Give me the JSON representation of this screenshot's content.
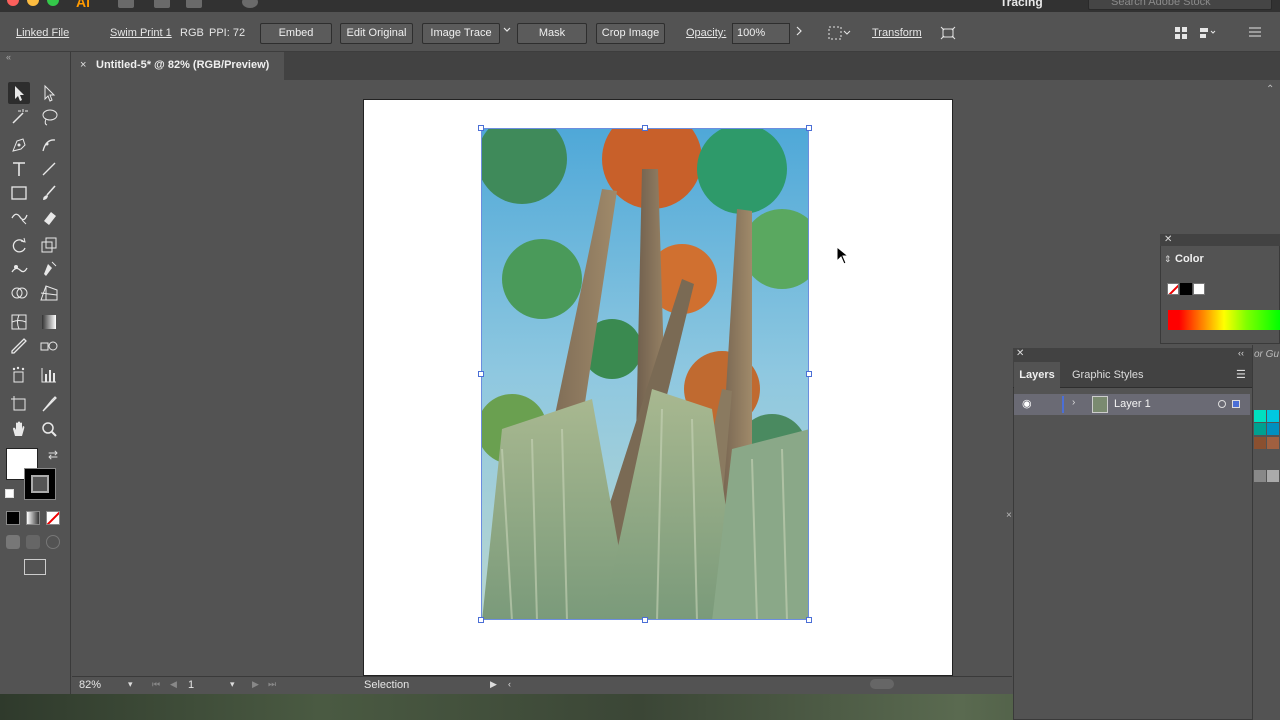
{
  "app": {
    "workspace": "Tracing",
    "stock_search_placeholder": "Search Adobe Stock",
    "logo": "Ai",
    "colors": {
      "selection": "#4b6fd6",
      "panel_bg": "#535353",
      "dark_bg": "#424242",
      "accent_logo": "#ff9a00"
    }
  },
  "controlbar": {
    "linked_file": "Linked File",
    "file_name": "Swim Print 1",
    "color_mode": "RGB",
    "ppi": "PPI: 72",
    "embed": "Embed",
    "edit_original": "Edit Original",
    "image_trace": "Image Trace",
    "mask": "Mask",
    "crop_image": "Crop Image",
    "opacity_label": "Opacity:",
    "opacity_value": "100%",
    "transform": "Transform"
  },
  "document": {
    "tab_title": "Untitled-5* @ 82% (RGB/Preview)",
    "close": "×"
  },
  "statusbar": {
    "zoom": "82%",
    "page": "1",
    "tool_status": "Selection"
  },
  "panels": {
    "color": {
      "title": "Color"
    },
    "layers": {
      "tabs": [
        "Layers",
        "Graphic Styles"
      ],
      "layer_name": "Layer 1"
    },
    "guide_partial": "or Gu"
  },
  "tools": [
    "selection-tool",
    "direct-selection-tool",
    "magic-wand-tool",
    "lasso-tool",
    "pen-tool",
    "curvature-tool",
    "type-tool",
    "line-segment-tool",
    "rectangle-tool",
    "paintbrush-tool",
    "shaper-tool",
    "eraser-tool",
    "rotate-tool",
    "scale-tool",
    "puppet-warp-tool",
    "free-transform-tool",
    "shape-builder-tool",
    "perspective-grid-tool",
    "mesh-tool",
    "gradient-tool",
    "eyedropper-tool",
    "blend-tool",
    "symbol-sprayer-tool",
    "column-graph-tool",
    "artboard-tool",
    "slice-tool",
    "hand-tool",
    "zoom-tool"
  ]
}
